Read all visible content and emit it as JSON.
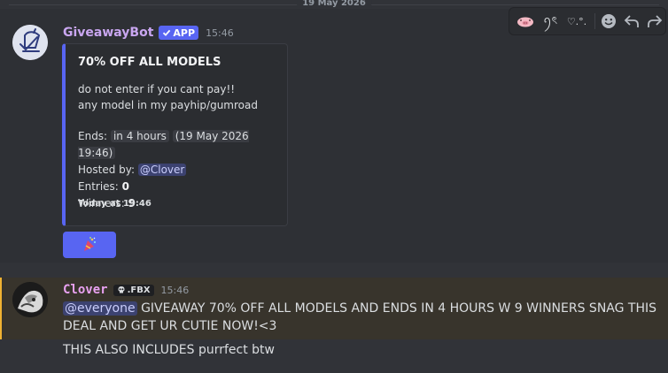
{
  "date_divider": "19 May 2026",
  "toolbar": {
    "icons": [
      "pig-emoji-icon",
      "doodle-emoji-icon",
      "sparkle-emoji-icon",
      "add-reaction-icon",
      "reply-icon",
      "forward-icon"
    ],
    "doodle_text": "ꪆৎ",
    "sparkle_text": "♡.°."
  },
  "message1": {
    "author": "GiveawayBot",
    "badge": "APP",
    "time": "15:46",
    "embed": {
      "accent": "#5865f2",
      "title": "70% OFF ALL MODELS",
      "desc_line1": "do not enter if you cant pay!!",
      "desc_line2": "any model in my payhip/gumroad",
      "ends_label": "Ends:",
      "ends_relative": "in 4 hours",
      "ends_absolute": "19 May 2026 19:46",
      "hosted_label": "Hosted by:",
      "host": "@Clover",
      "entries_label": "Entries:",
      "entries": "0",
      "winners_label": "Winners:",
      "winners": "9",
      "footer": "Today at 19:46"
    },
    "button_icon": "party-popper-icon"
  },
  "message2": {
    "author": "Clover",
    "tag": ".FBX",
    "tag_icon": "skull-icon",
    "time": "15:46",
    "mention": "@everyone",
    "text": "GIVEAWAY 70% OFF ALL MODELS AND ENDS IN 4 HOURS W 9 WINNERS SNAG THIS DEAL AND GET UR CUTIE NOW!<3",
    "highlight_color": "#f0b232"
  },
  "message3": {
    "text": "THIS ALSO INCLUDES purrfect btw"
  }
}
